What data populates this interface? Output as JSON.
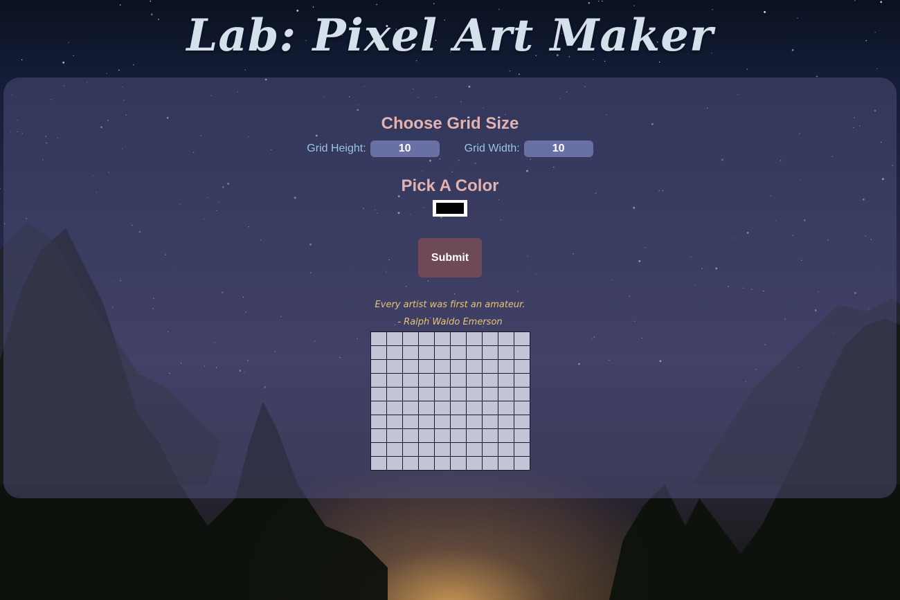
{
  "header": {
    "title": "Lab: Pixel Art Maker"
  },
  "grid_size": {
    "heading": "Choose Grid Size",
    "height_label": "Grid Height:",
    "height_value": "10",
    "width_label": "Grid Width:",
    "width_value": "10"
  },
  "color": {
    "heading": "Pick A Color",
    "selected_color": "#000000"
  },
  "form": {
    "submit_label": "Submit"
  },
  "quote": {
    "text": "Every artist was first an amateur.",
    "author": "- Ralph Waldo Emerson"
  },
  "canvas": {
    "rows": 10,
    "columns": 10,
    "cell_color": "#c2c4d8"
  },
  "colors": {
    "title": "#d4e0ec",
    "heading": "#e2b3b0",
    "label": "#9cc4e4",
    "input_bg": "#6870a4",
    "button_bg": "#6e4a58",
    "quote": "#e6c37a"
  }
}
